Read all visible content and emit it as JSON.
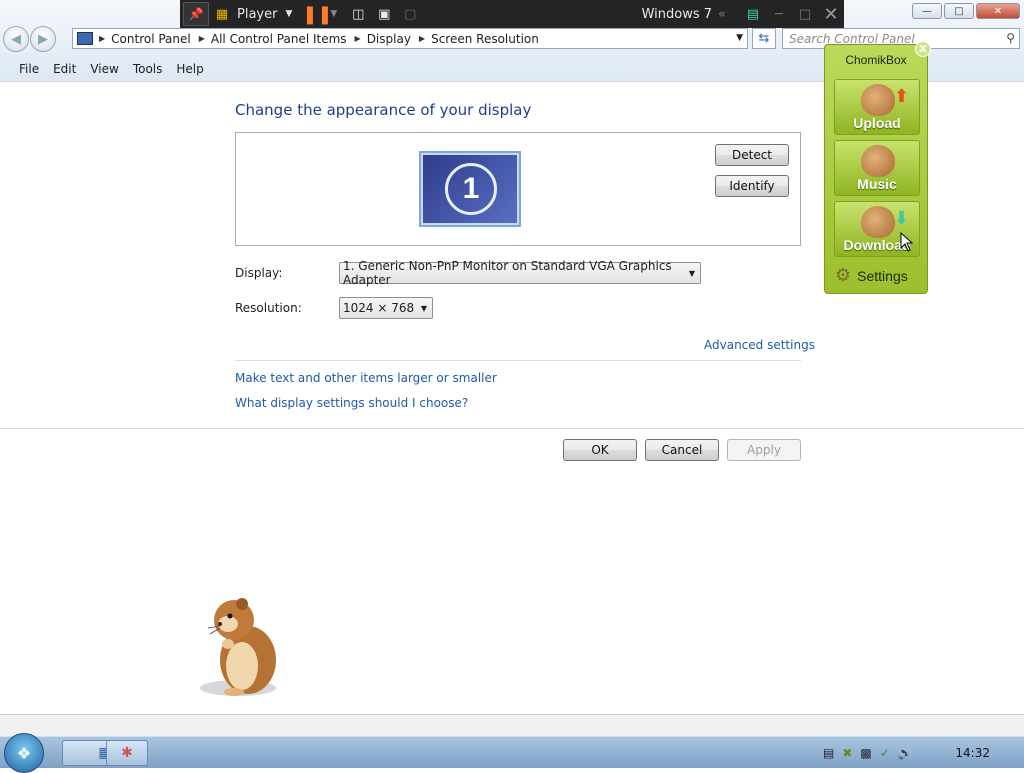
{
  "recorder": {
    "mode_label": "Player",
    "os_label": "Windows 7"
  },
  "window_buttons": {
    "minimize": "—",
    "maximize": "□",
    "close": "✕"
  },
  "address": {
    "crumbs": [
      "Control Panel",
      "All Control Panel Items",
      "Display",
      "Screen Resolution"
    ],
    "search_placeholder": "Search Control Panel"
  },
  "menu": {
    "file": "File",
    "edit": "Edit",
    "view": "View",
    "tools": "Tools",
    "help": "Help"
  },
  "main": {
    "title": "Change the appearance of your display",
    "monitor_number": "1",
    "detect_label": "Detect",
    "identify_label": "Identify",
    "display_label": "Display:",
    "display_value": "1. Generic Non-PnP Monitor on Standard VGA Graphics Adapter",
    "resolution_label": "Resolution:",
    "resolution_value": "1024 × 768",
    "advanced_link": "Advanced settings",
    "text_size_link": "Make text and other items larger or smaller",
    "help_link": "What display settings should I choose?",
    "ok_label": "OK",
    "cancel_label": "Cancel",
    "apply_label": "Apply"
  },
  "chomikbox": {
    "title": "ChomikBox",
    "close": "X",
    "upload": "Upload",
    "music": "Music",
    "download": "Download",
    "settings": "Settings"
  },
  "taskbar": {
    "clock": "14:32"
  },
  "colors": {
    "accent": "#1e5aa8",
    "title": "#1e3f8c",
    "widget": "#a8c83a"
  }
}
